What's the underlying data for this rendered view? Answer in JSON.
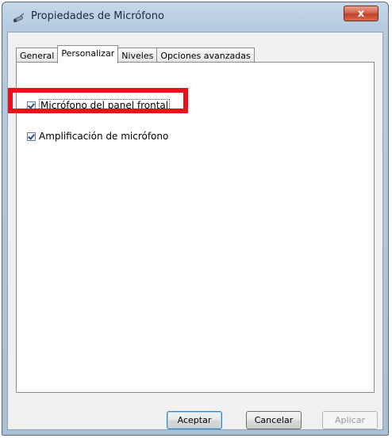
{
  "window": {
    "title": "Propiedades de Micrófono",
    "close_label": "x"
  },
  "tabs": [
    {
      "label": "General",
      "active": false
    },
    {
      "label": "Personalizar",
      "active": true
    },
    {
      "label": "Niveles",
      "active": false
    },
    {
      "label": "Opciones avanzadas",
      "active": false
    }
  ],
  "options": [
    {
      "label": "Micrófono del panel frontal",
      "checked": true
    },
    {
      "label": "Amplificación de micrófono",
      "checked": true
    }
  ],
  "annotation": {
    "highlight_color": "#e5141b"
  },
  "buttons": {
    "ok": "Aceptar",
    "cancel": "Cancelar",
    "apply": "Aplicar"
  }
}
